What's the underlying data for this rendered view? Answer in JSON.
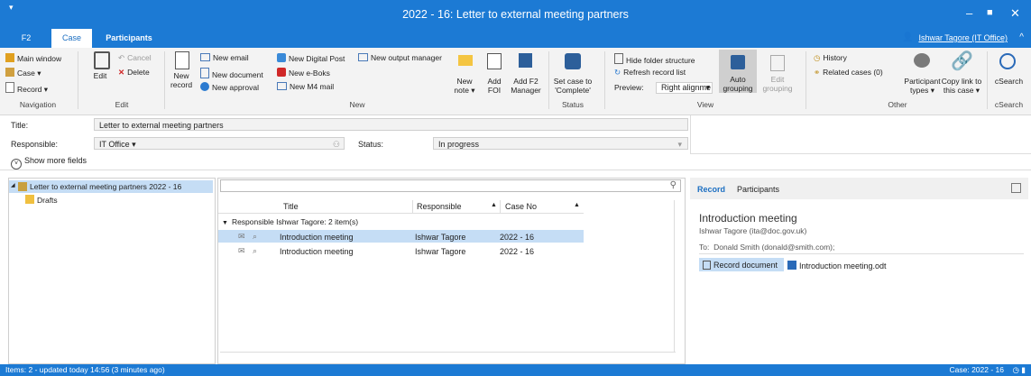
{
  "window": {
    "title": "2022 - 16: Letter to external meeting partners",
    "user": "Ishwar Tagore (IT Office)"
  },
  "tabs": [
    "F2",
    "Case",
    "Participants"
  ],
  "ribbon": {
    "nav": {
      "main_window": "Main window",
      "case": "Case ▾",
      "record": "Record ▾",
      "group": "Navigation"
    },
    "edit": {
      "edit": "Edit",
      "cancel": "Cancel",
      "delete": "Delete",
      "group": "Edit"
    },
    "new": {
      "new_record_1": "New",
      "new_record_2": "record",
      "new_email": "New email",
      "new_document": "New document",
      "new_approval": "New approval",
      "new_digital_post": "New Digital Post",
      "new_eboks": "New e-Boks",
      "new_m4": "New M4 mail",
      "new_output": "New output manager",
      "new_note_1": "New",
      "new_note_2": "note ▾",
      "add_foi_1": "Add",
      "add_foi_2": "FOI",
      "add_f2_1": "Add F2",
      "add_f2_2": "Manager",
      "group": "New"
    },
    "status": {
      "set_1": "Set case to",
      "set_2": "'Complete'",
      "group": "Status"
    },
    "view": {
      "hide_folder": "Hide folder structure",
      "refresh": "Refresh record list",
      "preview_label": "Preview:",
      "preview_value": "Right alignme",
      "auto_1": "Auto",
      "auto_2": "grouping",
      "editg_1": "Edit",
      "editg_2": "grouping",
      "group": "View"
    },
    "other": {
      "history": "History",
      "related": "Related cases (0)",
      "ptypes_1": "Participant",
      "ptypes_2": "types ▾",
      "copy_1": "Copy link to",
      "copy_2": "this case ▾",
      "group": "Other"
    },
    "csearch": {
      "label": "cSearch",
      "group": "cSearch"
    }
  },
  "fields": {
    "title_label": "Title:",
    "title_value": "Letter to external meeting partners",
    "resp_label": "Responsible:",
    "resp_value": "IT Office ▾",
    "status_label": "Status:",
    "status_value": "In progress",
    "show_more": "Show more fields"
  },
  "tree": {
    "case": "Letter to external meeting partners 2022 - 16",
    "drafts": "Drafts"
  },
  "list": {
    "cols": [
      "Title",
      "Responsible",
      "Case No"
    ],
    "group_header": "Responsible Ishwar Tagore: 2 item(s)",
    "rows": [
      {
        "title": "Introduction meeting",
        "responsible": "Ishwar Tagore",
        "caseno": "2022 - 16"
      },
      {
        "title": "Introduction meeting",
        "responsible": "Ishwar Tagore",
        "caseno": "2022 - 16"
      }
    ]
  },
  "preview": {
    "tab_record": "Record",
    "tab_participants": "Participants",
    "subject": "Introduction meeting",
    "from": "Ishwar Tagore (ita@doc.gov.uk)",
    "to_label": "To:",
    "to_value": "Donald Smith (donald@smith.com);",
    "doc_button": "Record document",
    "attachment": "Introduction meeting.odt"
  },
  "statusbar": {
    "left": "Items: 2 - updated today 14:56 (3 minutes ago)",
    "right": "Case: 2022 - 16"
  },
  "colors": {
    "accent": "#1c7ad4",
    "selection": "#c5ddf5"
  }
}
